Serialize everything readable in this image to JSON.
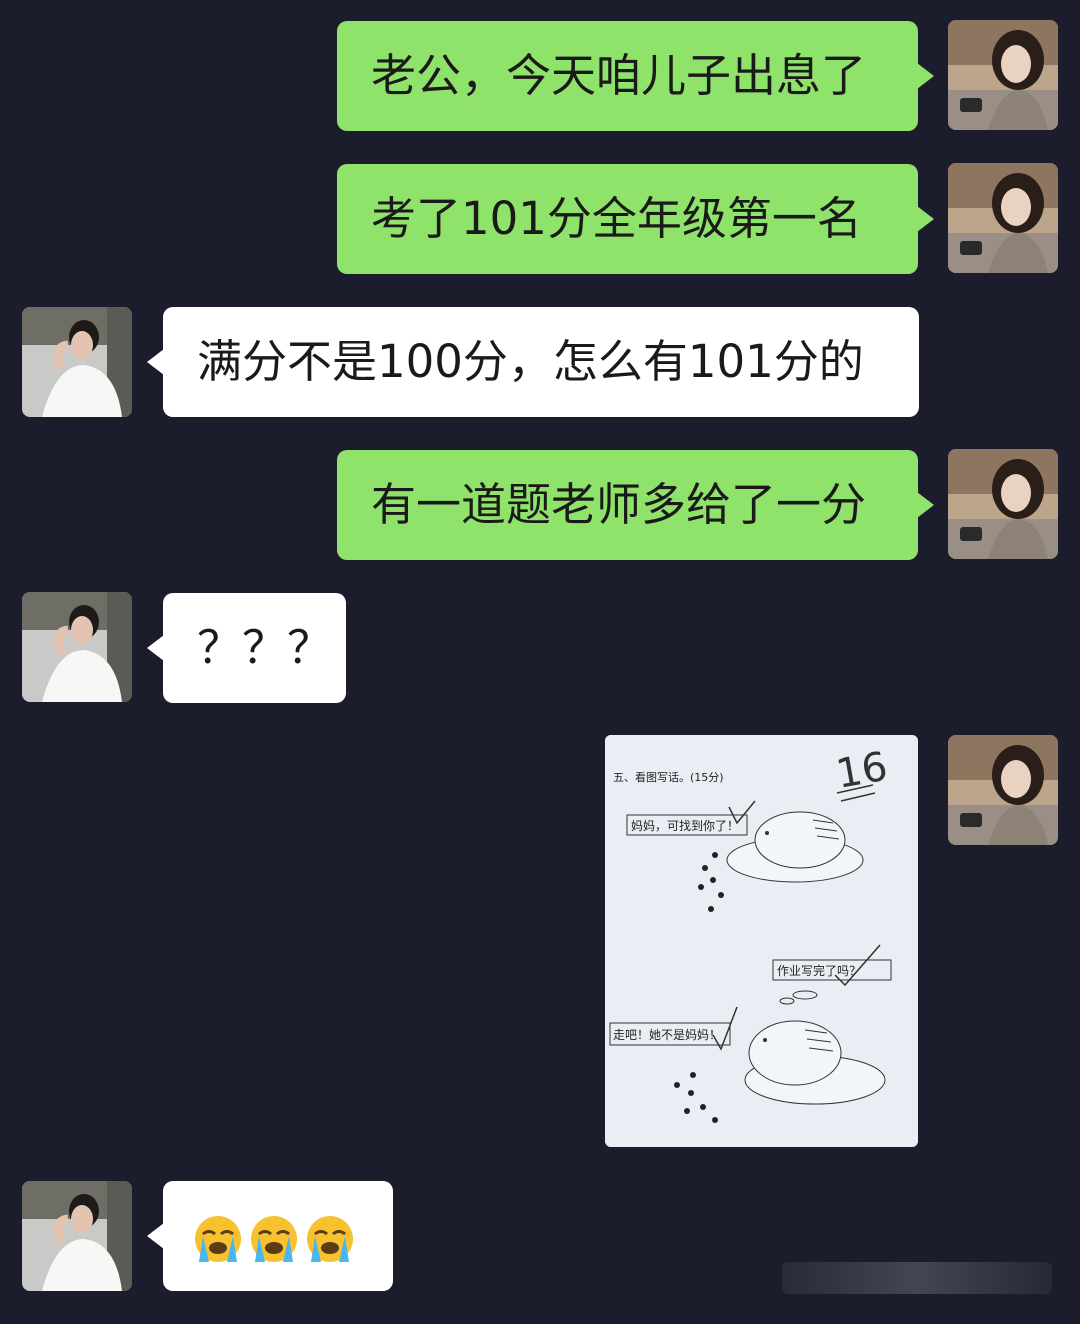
{
  "chat": {
    "messages": [
      {
        "side": "right",
        "type": "text",
        "text": "老公，今天咱儿子出息了"
      },
      {
        "side": "right",
        "type": "text",
        "text": "考了101分全年级第一名"
      },
      {
        "side": "left",
        "type": "text",
        "text": "满分不是100分，怎么有101分的"
      },
      {
        "side": "right",
        "type": "text",
        "text": "有一道题老师多给了一分"
      },
      {
        "side": "left",
        "type": "text",
        "text": "？？？"
      },
      {
        "side": "right",
        "type": "image"
      },
      {
        "side": "left",
        "type": "emoji",
        "emoji": [
          "loudly-crying-face-icon",
          "loudly-crying-face-icon",
          "loudly-crying-face-icon"
        ]
      }
    ]
  },
  "worksheet": {
    "heading": "五、看图写话。(15分)",
    "score": "16",
    "bubble_1": "妈妈，可找到你了！",
    "bubble_2": "作业写完了吗？",
    "bubble_3": "走吧！她不是妈妈！"
  },
  "colors": {
    "background": "#1b1d2c",
    "sent_bubble": "#8fe26a",
    "received_bubble": "#ffffff"
  }
}
